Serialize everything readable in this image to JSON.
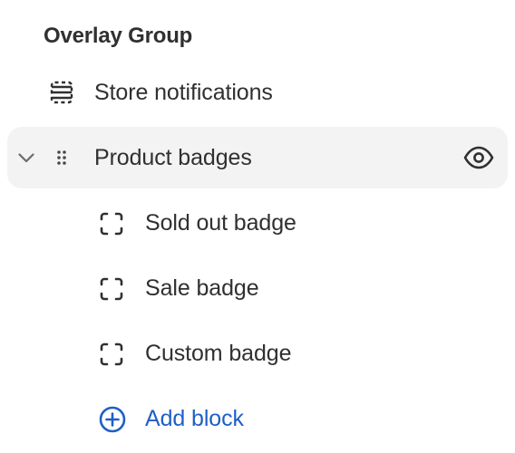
{
  "section": {
    "title": "Overlay Group"
  },
  "items": [
    {
      "label": "Store notifications",
      "icon": "section-layout-icon",
      "selected": false
    },
    {
      "label": "Product badges",
      "icon": "drag-handle-icon",
      "selected": true,
      "expanded": true,
      "visibility_icon": "eye-icon",
      "children": [
        {
          "label": "Sold out badge",
          "icon": "block-frame-icon"
        },
        {
          "label": "Sale badge",
          "icon": "block-frame-icon"
        },
        {
          "label": "Custom badge",
          "icon": "block-frame-icon"
        }
      ]
    }
  ],
  "add_block": {
    "label": "Add block",
    "icon": "plus-circle-icon",
    "color": "#1f5fc7"
  },
  "colors": {
    "text": "#303030",
    "selected_row_bg": "#f3f3f3",
    "accent": "#1f5fc7"
  }
}
